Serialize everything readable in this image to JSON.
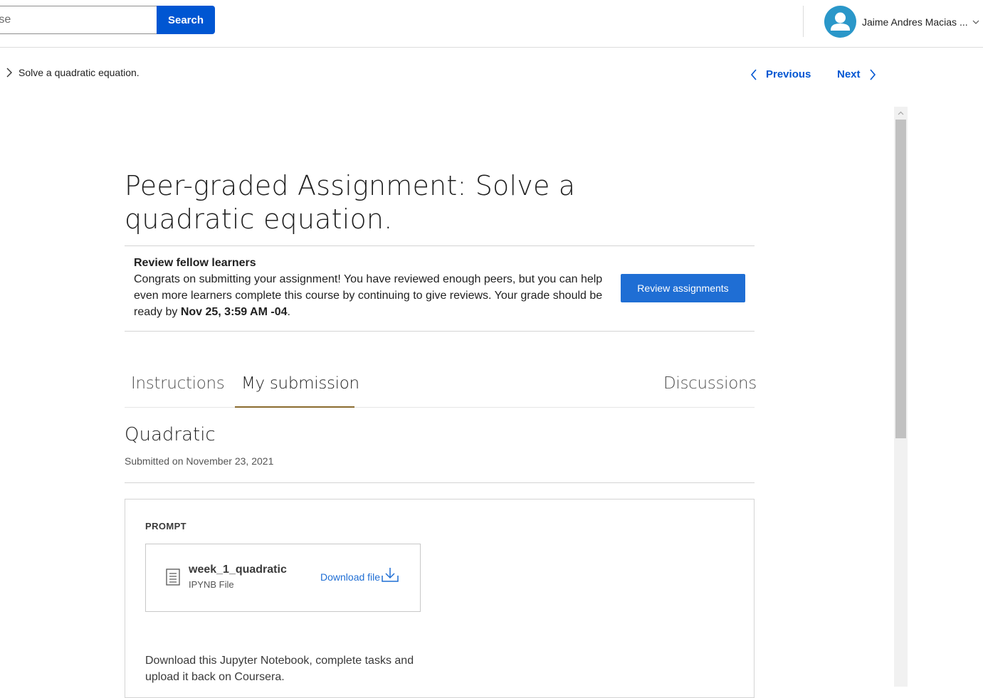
{
  "header": {
    "search_placeholder": "rse",
    "search_button": "Search",
    "user_name": "Jaime Andres Macias ..."
  },
  "breadcrumb": {
    "current": "Solve a quadratic equation."
  },
  "nav": {
    "previous": "Previous",
    "next": "Next"
  },
  "main": {
    "title": "Peer-graded Assignment: Solve a quadratic equation.",
    "review": {
      "heading": "Review fellow learners",
      "text_before": "Congrats on submitting your assignment! You have reviewed enough peers, but you can help even more learners complete this course by continuing to give reviews. Your grade should be ready by ",
      "date": "Nov 25, 3:59 AM -04",
      "text_after": ".",
      "button": "Review assignments"
    },
    "tabs": [
      {
        "label": "Instructions",
        "active": false
      },
      {
        "label": "My submission",
        "active": true
      },
      {
        "label": "Discussions",
        "active": false
      }
    ],
    "submission": {
      "title": "Quadratic",
      "submitted_on": "Submitted on November 23, 2021"
    },
    "prompt": {
      "label": "PROMPT",
      "file_name": "week_1_quadratic",
      "file_type": "IPYNB File",
      "download": "Download file",
      "text": "Download this Jupyter Notebook, complete tasks and upload it back on Coursera."
    }
  },
  "colors": {
    "brand_blue": "#0056d2",
    "button_blue": "#1f6ed4",
    "avatar": "#2a97c9",
    "tab_underline": "#8a6a2e"
  }
}
